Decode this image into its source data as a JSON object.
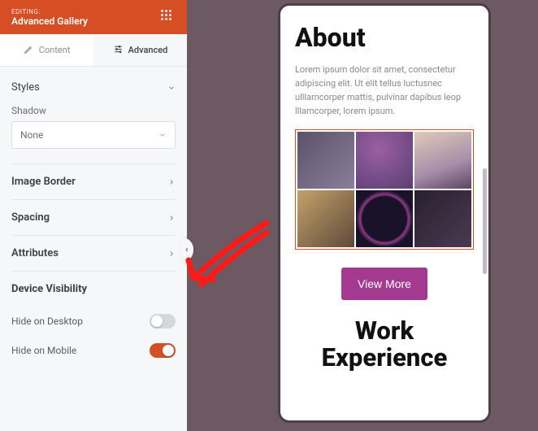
{
  "header": {
    "editing_label": "EDITING:",
    "block_title": "Advanced Gallery"
  },
  "tabs": {
    "content": "Content",
    "advanced": "Advanced"
  },
  "panel": {
    "styles_label": "Styles",
    "shadow_label": "Shadow",
    "shadow_value": "None",
    "image_border_label": "Image Border",
    "spacing_label": "Spacing",
    "attributes_label": "Attributes",
    "device_visibility_label": "Device Visibility",
    "hide_desktop_label": "Hide on Desktop",
    "hide_mobile_label": "Hide on Mobile"
  },
  "toggles": {
    "hide_desktop": false,
    "hide_mobile": true
  },
  "preview": {
    "about_title": "About",
    "about_text": "Lorem ipsum dolor sit amet, consectetur adipiscing elit. Ut elit tellus luctusnec ulllamcorper mattis, pulvinar dapibus leop lllamcorper, lorem ipsum.",
    "view_more": "View More",
    "work_title": "Work Experience"
  },
  "colors": {
    "accent": "#d54e24",
    "cta": "#a43a90"
  }
}
